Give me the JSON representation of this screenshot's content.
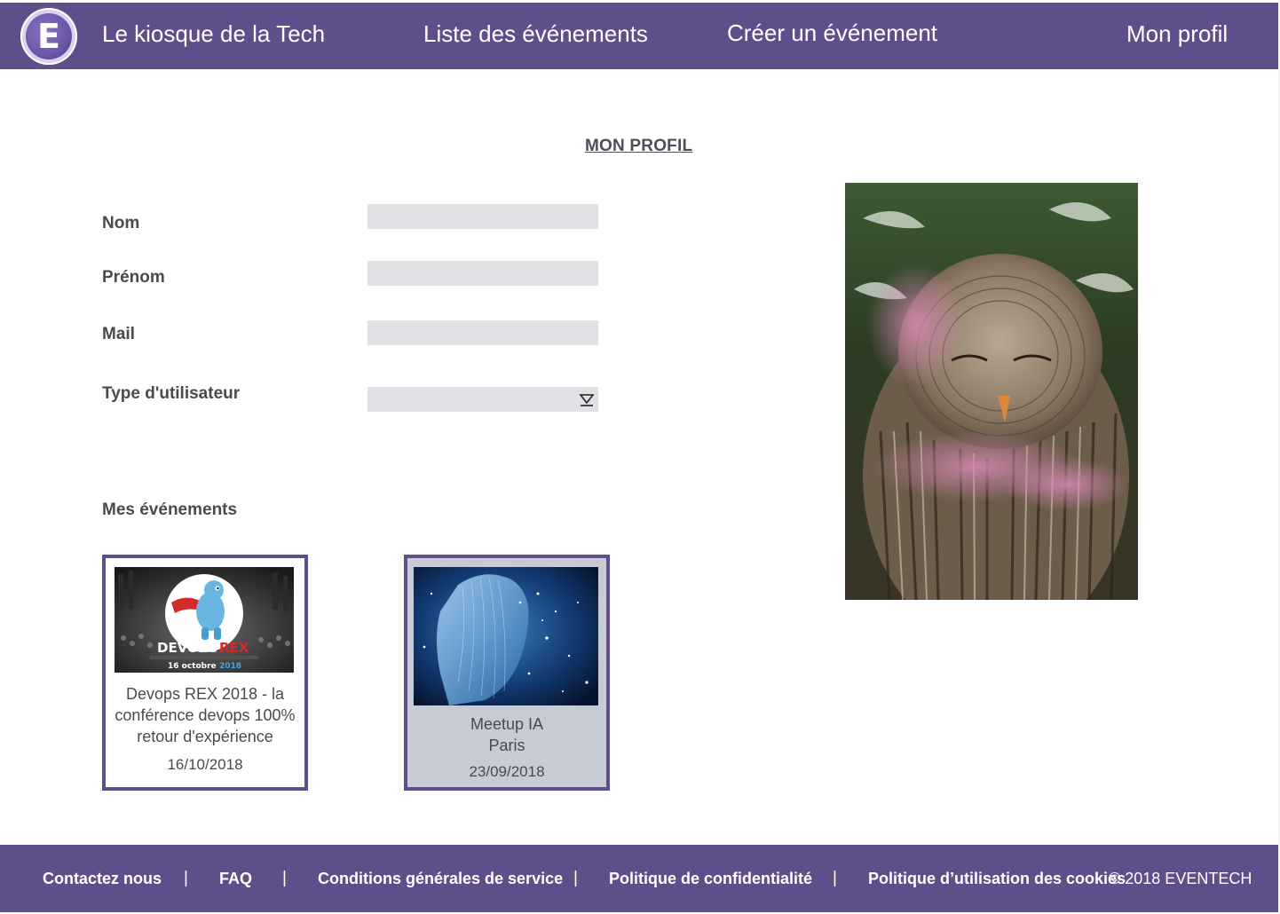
{
  "header": {
    "logo_letter": "E",
    "brand": "Le kiosque de la Tech",
    "nav": {
      "events_list": "Liste des événements",
      "create_event": "Créer un événement",
      "my_profile": "Mon profil"
    },
    "color": "#5e4f8a"
  },
  "main": {
    "title": "MON PROFIL",
    "form": {
      "last_name_label": "Nom",
      "first_name_label": "Prénom",
      "mail_label": "Mail",
      "user_type_label": "Type d'utilisateur",
      "last_name_value": "",
      "first_name_value": "",
      "mail_value": "",
      "user_type_value": ""
    },
    "my_events_title": "Mes événements",
    "events": [
      {
        "name": "Devops REX 2018 - la\nconférence devops 100%\nretour d'expérience",
        "date": "16/10/2018",
        "image_text_main": "DEVOPS",
        "image_text_accent": "REX",
        "image_date_text": "16 octobre",
        "image_year": "2018"
      },
      {
        "name": "Meetup IA\nParis",
        "date": "23/09/2018"
      }
    ]
  },
  "footer": {
    "contact": "Contactez nous",
    "faq": "FAQ",
    "terms": "Conditions générales de service",
    "privacy": "Politique de confidentialité",
    "cookies": "Politique d’utilisation des cookies",
    "separator": "|",
    "copyright": "© 2018 EVENTECH"
  },
  "colors": {
    "accent": "#5e4f8a",
    "input_bg": "#dfe1e5",
    "selected_card_bg": "#c7cbd5"
  }
}
